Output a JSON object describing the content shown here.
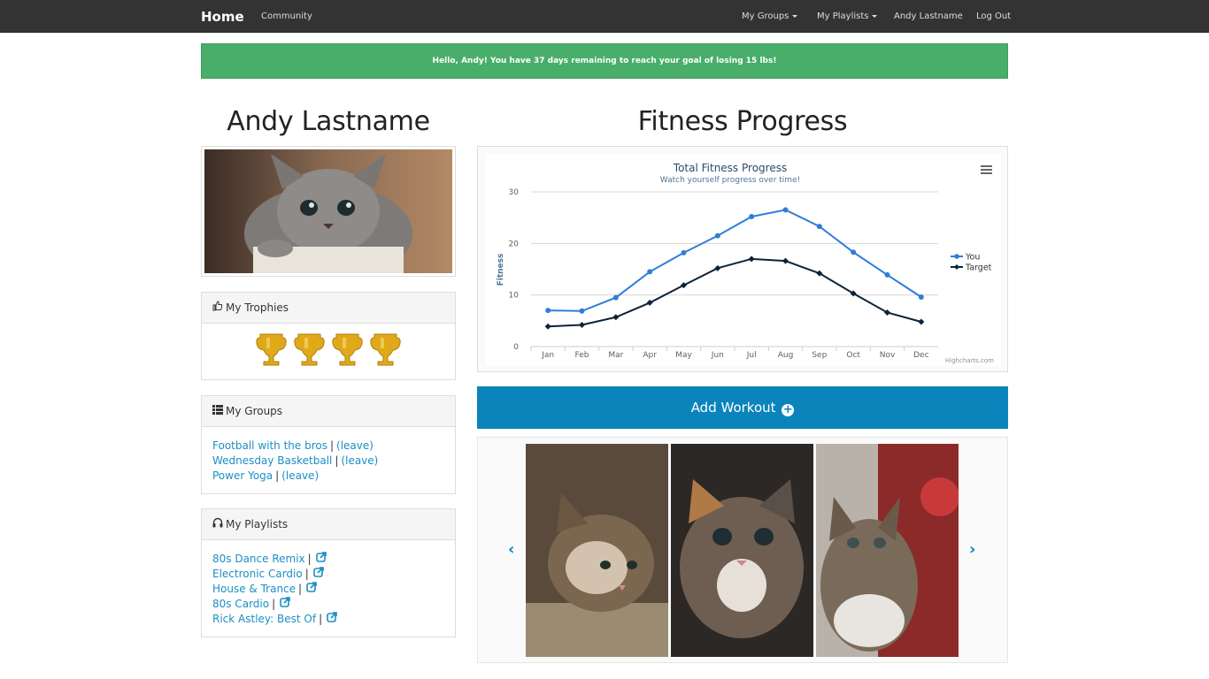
{
  "navbar": {
    "brand": "Home",
    "community": "Community",
    "my_groups": "My Groups",
    "my_playlists": "My Playlists",
    "user": "Andy Lastname",
    "logout": "Log Out"
  },
  "alert": {
    "message": "Hello, Andy! You have 37 days remaining to reach your goal of losing 15 lbs!"
  },
  "profile": {
    "name": "Andy Lastname"
  },
  "trophies": {
    "title": "My Trophies",
    "count": 4
  },
  "groups": {
    "title": "My Groups",
    "items": [
      {
        "name": "Football with the bros",
        "action": "(leave)"
      },
      {
        "name": "Wednesday Basketball",
        "action": "(leave)"
      },
      {
        "name": "Power Yoga",
        "action": "(leave)"
      }
    ],
    "separator": "|"
  },
  "playlists": {
    "title": "My Playlists",
    "items": [
      {
        "name": "80s Dance Remix"
      },
      {
        "name": "Electronic Cardio"
      },
      {
        "name": "House & Trance"
      },
      {
        "name": "80s Cardio"
      },
      {
        "name": "Rick Astley: Best Of"
      }
    ]
  },
  "main": {
    "title": "Fitness Progress",
    "add_workout": "Add Workout"
  },
  "chart_data": {
    "type": "line",
    "title": "Total Fitness Progress",
    "subtitle": "Watch yourself progress over time!",
    "ylabel": "Fitness",
    "xlabel": "",
    "categories": [
      "Jan",
      "Feb",
      "Mar",
      "Apr",
      "May",
      "Jun",
      "Jul",
      "Aug",
      "Sep",
      "Oct",
      "Nov",
      "Dec"
    ],
    "ylim": [
      0,
      30
    ],
    "yticks": [
      0,
      10,
      20,
      30
    ],
    "grid": true,
    "legend": "right",
    "credit": "Highcharts.com",
    "series": [
      {
        "name": "You",
        "color": "#2f7ed8",
        "marker": "circle",
        "values": [
          7.0,
          6.9,
          9.5,
          14.5,
          18.2,
          21.5,
          25.2,
          26.5,
          23.3,
          18.3,
          13.9,
          9.6
        ]
      },
      {
        "name": "Target",
        "color": "#0d233a",
        "marker": "diamond",
        "values": [
          3.9,
          4.2,
          5.7,
          8.5,
          11.9,
          15.2,
          17.0,
          16.6,
          14.2,
          10.3,
          6.6,
          4.8
        ]
      }
    ]
  },
  "colors": {
    "navbar": "#333333",
    "alert": "#48ae69",
    "accent": "#0b84bb",
    "link": "#1b8fc4"
  }
}
